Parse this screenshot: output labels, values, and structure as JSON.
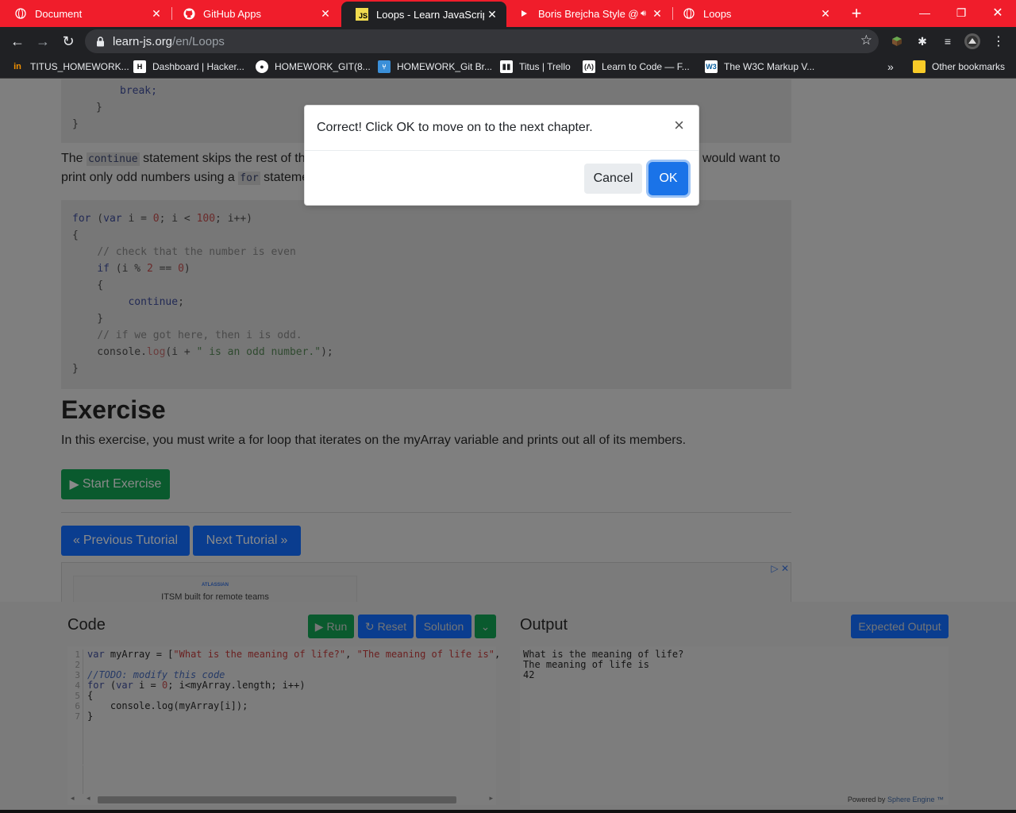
{
  "browser": {
    "tabs": [
      {
        "title": "Document",
        "icon": "globe-icon",
        "active": false
      },
      {
        "title": "GitHub Apps",
        "icon": "github-icon",
        "active": false
      },
      {
        "title": "Loops - Learn JavaScript - F",
        "icon": "js-icon",
        "active": true
      },
      {
        "title": "Boris Brejcha Style @ A",
        "icon": "youtube-icon",
        "active": false
      },
      {
        "title": "Loops",
        "icon": "globe-icon",
        "active": false
      }
    ],
    "new_tab": "+",
    "url_domain": "learn-js.org",
    "url_path": "/en/Loops",
    "bookmarks": [
      {
        "label": "TITUS_HOMEWORK...",
        "icon": "in"
      },
      {
        "label": "Dashboard | Hacker...",
        "icon": "H"
      },
      {
        "label": "HOMEWORK_GIT(8...",
        "icon": "gh"
      },
      {
        "label": "HOMEWORK_Git Br...",
        "icon": "gi"
      },
      {
        "label": "Titus | Trello",
        "icon": "tr"
      },
      {
        "label": "Learn to Code — F...",
        "icon": "fc"
      },
      {
        "label": "The W3C Markup V...",
        "icon": "W3"
      }
    ],
    "bookmarks_overflow": "»",
    "other_bookmarks": "Other bookmarks"
  },
  "page": {
    "break_line": "break;",
    "continue_para_start": "The ",
    "continue_code": "continue",
    "continue_para_mid": " statement skips the rest of the",
    "continue_para_right": "would want to",
    "continue_para_line2_start": "print only odd numbers using a ",
    "for_code": "for",
    "continue_para_line2_end": " stateme",
    "exercise_title": "Exercise",
    "exercise_text": "In this exercise, you must write a for loop that iterates on the myArray variable and prints out all of its members.",
    "start_exercise": "Start Exercise",
    "prev_tutorial": "Previous Tutorial",
    "next_tutorial": "Next Tutorial",
    "ad_brand": "ATLASSIAN",
    "ad_text": "ITSM built for remote teams"
  },
  "panel": {
    "code_title": "Code",
    "run": "Run",
    "reset": "Reset",
    "solution": "Solution",
    "output_title": "Output",
    "expected_output": "Expected Output",
    "line_numbers": "1\n2\n3\n4\n5\n6\n7",
    "output_text": "What is the meaning of life?\nThe meaning of life is\n42",
    "powered_by": "Powered by",
    "sphere_engine": "Sphere Engine ™"
  },
  "modal": {
    "message": "Correct! Click OK to move on to the next chapter.",
    "close": "×",
    "cancel": "Cancel",
    "ok": "OK"
  },
  "colors": {
    "tabbar": "#f01d2b",
    "toolbar": "#202124",
    "ok_button": "#1a73e8",
    "green_button": "#198754",
    "blue_button": "#0d6efd"
  }
}
